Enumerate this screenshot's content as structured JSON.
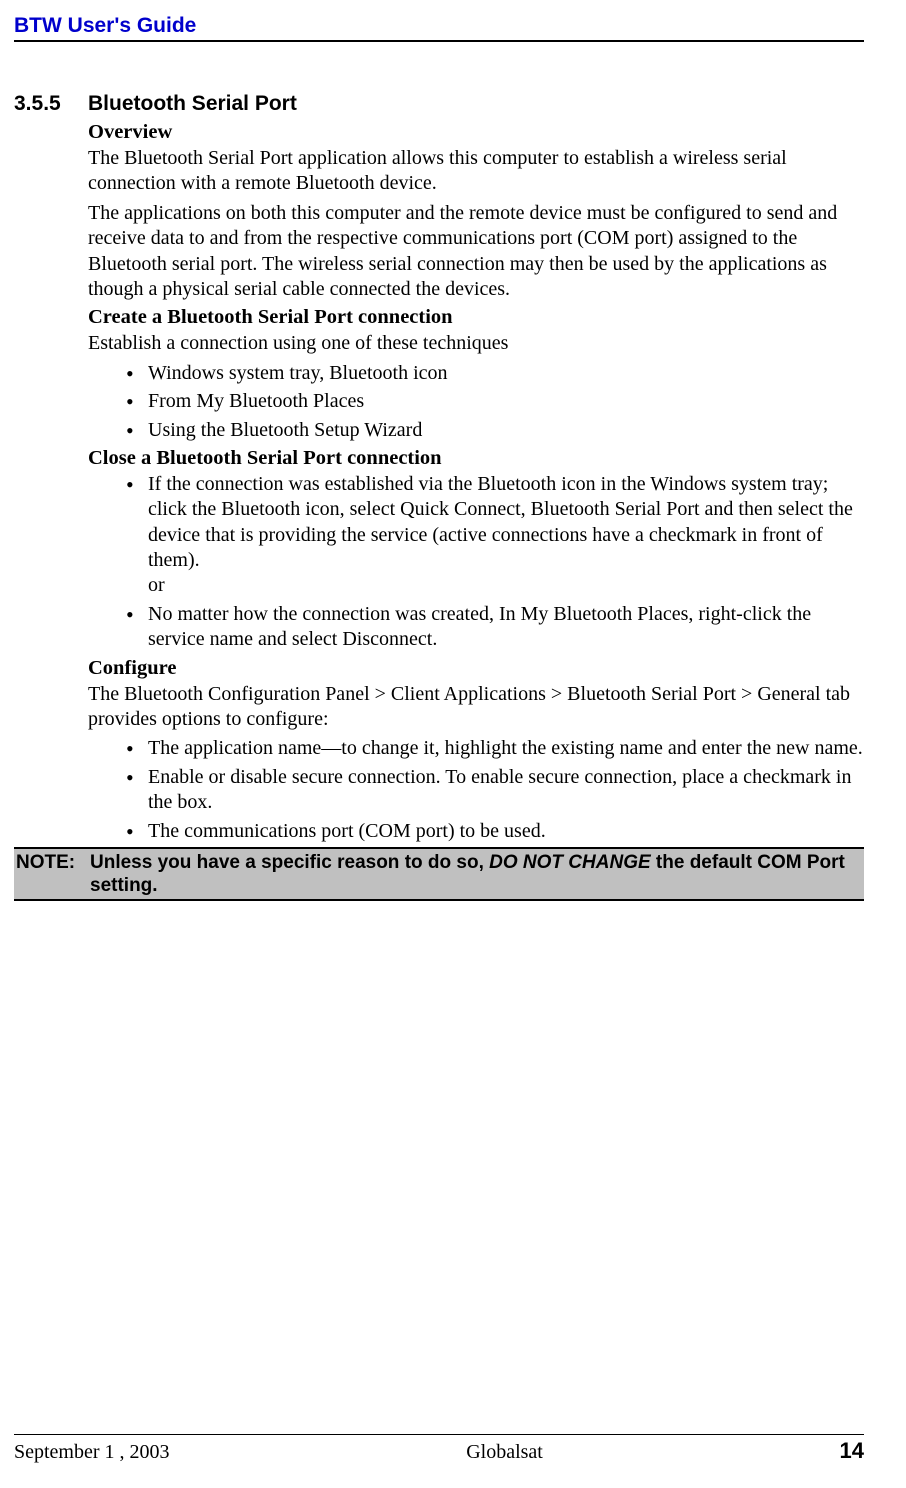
{
  "header": {
    "title": "BTW User's Guide"
  },
  "section": {
    "number": "3.5.5",
    "title": "Bluetooth Serial Port"
  },
  "overview": {
    "heading": "Overview",
    "p1": "The Bluetooth Serial Port application allows this computer to establish a wireless serial connection with a remote Bluetooth device.",
    "p2": "The applications on both this computer and the remote device must be configured to send and receive data to and from the respective communications port (COM port) assigned to the Bluetooth serial port. The wireless serial connection may then be used by the applications as though a physical serial cable connected the devices."
  },
  "create": {
    "heading": "Create a Bluetooth Serial Port connection",
    "intro": "Establish a connection using one of these techniques",
    "items": [
      "Windows system tray, Bluetooth icon",
      "From My Bluetooth Places",
      "Using the Bluetooth Setup Wizard"
    ]
  },
  "close": {
    "heading": "Close a Bluetooth Serial Port connection",
    "items": [
      "If the connection was established via the Bluetooth icon in the Windows system tray; click the Bluetooth icon, select Quick Connect, Bluetooth Serial Port and then select the device that is providing the service (active connections have a checkmark in front of them).\nor",
      "No matter how the connection was created, In My Bluetooth Places, right-click the service name and select Disconnect."
    ]
  },
  "configure": {
    "heading": "Configure",
    "intro": "The Bluetooth Configuration Panel > Client Applications > Bluetooth Serial Port > General tab provides options to configure:",
    "items": [
      "The application name—to change it, highlight the existing name and enter the new name.",
      "Enable or disable secure connection. To enable secure connection, place a checkmark in the box.",
      "The communications port (COM port) to be used."
    ]
  },
  "note": {
    "label": "NOTE:",
    "text_before": "Unless you have a specific reason to do so, ",
    "emph": "DO NOT CHANGE",
    "text_after": " the default COM Port setting."
  },
  "footer": {
    "left": "September 1 , 2003",
    "center": "Globalsat",
    "right": "14"
  }
}
